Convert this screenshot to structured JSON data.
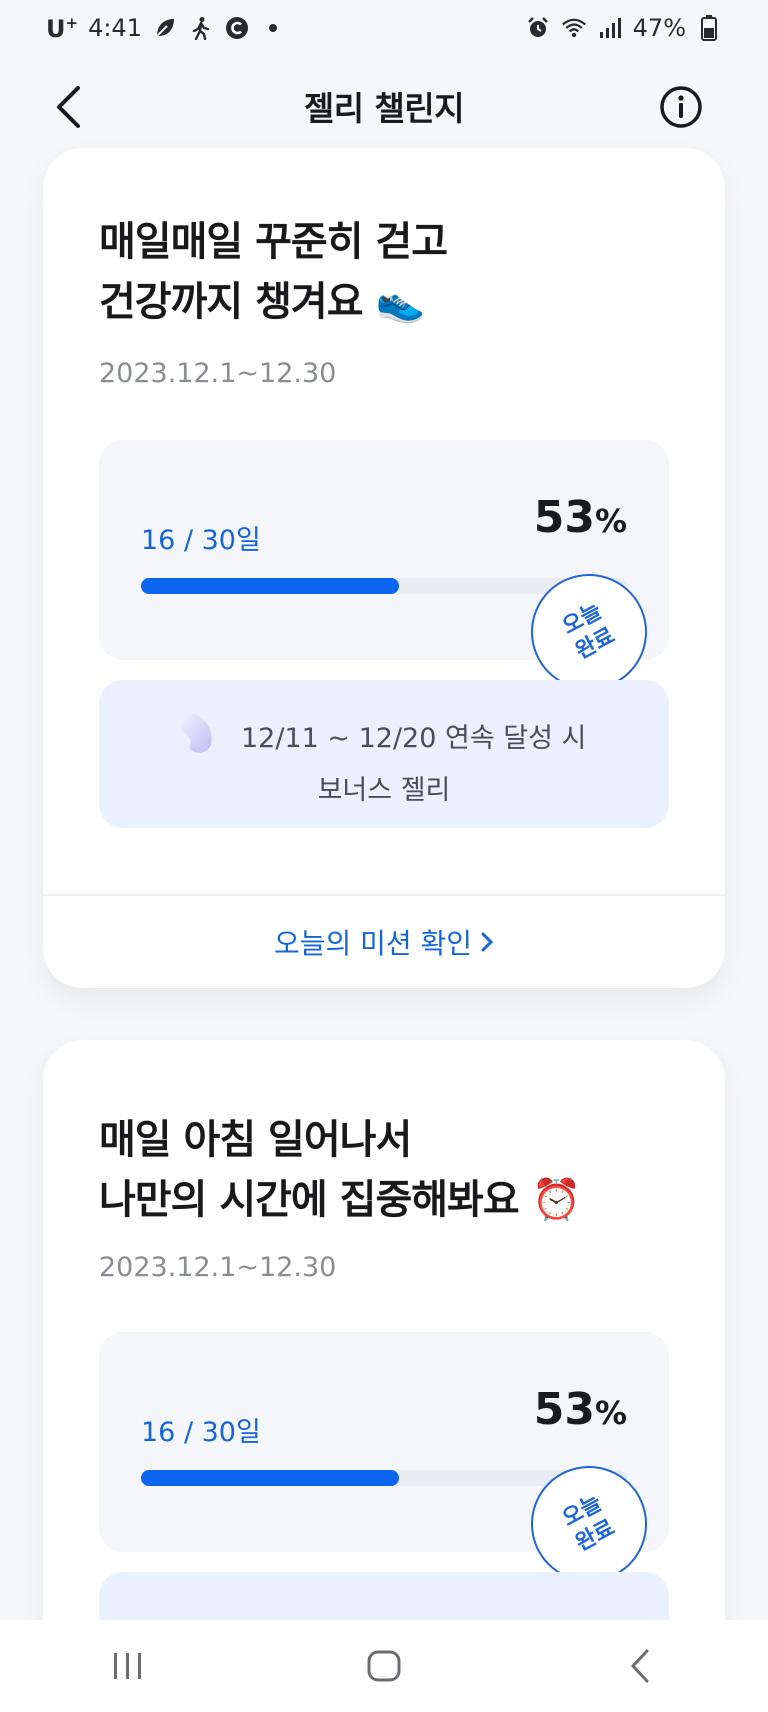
{
  "status_bar": {
    "carrier": "U",
    "carrier_sup": "+",
    "time": "4:41",
    "battery": "47%"
  },
  "header": {
    "title": "젤리 챌린지"
  },
  "cards": [
    {
      "title_line1": "매일매일 꾸준히 걷고",
      "title_line2": "건강까지 챙겨요",
      "title_emoji": "👟",
      "date_range": "2023.12.1~12.30",
      "days": "16 / 30일",
      "percent": "53",
      "percent_unit": "%",
      "progress": 0.53,
      "stamp_line1": "오늘",
      "stamp_line2": "완료",
      "bonus_line1": "12/11 ~ 12/20 연속 달성 시",
      "bonus_line2": "보너스 젤리",
      "mission_link": "오늘의 미션 확인"
    },
    {
      "title_line1": "매일 아침 일어나서",
      "title_line2": "나만의 시간에 집중해봐요",
      "title_emoji": "⏰",
      "date_range": "2023.12.1~12.30",
      "days": "16 / 30일",
      "percent": "53",
      "percent_unit": "%",
      "progress": 0.53,
      "stamp_line1": "오늘",
      "stamp_line2": "완료"
    }
  ],
  "colors": {
    "accent": "#0a66f0",
    "link": "#1466d8",
    "bonus_bg": "#eaf0fd"
  },
  "icons": {
    "back": "chevron-left-icon",
    "info": "info-icon",
    "jelly": "jelly-bean-icon",
    "mission_arrow": "chevron-right-icon"
  }
}
